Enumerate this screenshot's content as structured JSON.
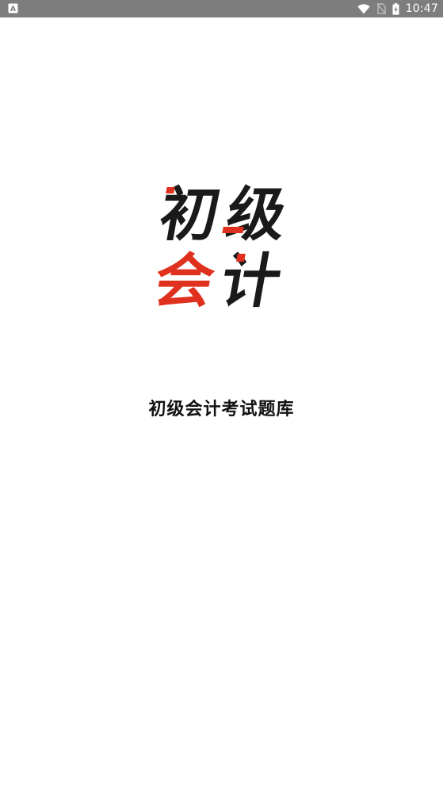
{
  "status_bar": {
    "time": "10:47",
    "icons": [
      "notification-a-icon",
      "wifi-icon",
      "no-sim-icon",
      "battery-charging-icon"
    ]
  },
  "logo": {
    "line1": [
      "初",
      "级"
    ],
    "line2": [
      "会",
      "计"
    ],
    "colors": {
      "dark": "#1a1a1a",
      "accent": "#e0301e"
    }
  },
  "app_name": "初级会计考试题库"
}
